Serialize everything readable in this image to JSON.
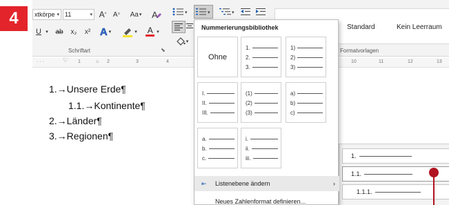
{
  "step_badge": "4",
  "ribbon": {
    "font_name": "xtkörpe",
    "font_size": "11",
    "grow_font": "A",
    "shrink_font": "A",
    "change_case": "Aa",
    "underline": "U",
    "strikethrough": "ab",
    "subscript": "x₂",
    "superscript": "x²",
    "text_effects": "A",
    "font_color": "A",
    "font_group_label": "Schriftart",
    "styles_group_label": "Formatvorlagen",
    "styles": [
      "Standard",
      "Kein Leerraum"
    ]
  },
  "ruler": {
    "left_ticks": [
      "1",
      "2",
      "3",
      "4"
    ],
    "right_ticks": [
      "10",
      "11",
      "12",
      "13"
    ]
  },
  "document": {
    "lines": [
      "1.→Unsere Erde¶",
      "1.1.→Kontinente¶",
      "2.→Länder¶",
      "3.→Regionen¶"
    ]
  },
  "numbering_dropdown": {
    "title": "Nummerierungsbibliothek",
    "none_label": "Ohne",
    "tiles": [
      {
        "markers": [
          "1.",
          "2.",
          "3."
        ]
      },
      {
        "markers": [
          "1)",
          "2)",
          "3)"
        ]
      },
      {
        "markers": [
          "I.",
          "II.",
          "III."
        ]
      },
      {
        "markers": [
          "(1)",
          "(2)",
          "(3)"
        ]
      },
      {
        "markers": [
          "a)",
          "b)",
          "c)"
        ]
      },
      {
        "markers": [
          "a.",
          "b.",
          "c."
        ]
      },
      {
        "markers": [
          "i.",
          "ii.",
          "iii."
        ]
      }
    ],
    "change_level_label": "Listenebene ändern",
    "define_format_label": "Neues Zahlenformat definieren..."
  },
  "level_panel": {
    "levels": [
      "1.",
      "1.1.",
      "1.1.1."
    ]
  },
  "colors": {
    "badge_red": "#e3242b",
    "pointer_red": "#b1121f"
  }
}
